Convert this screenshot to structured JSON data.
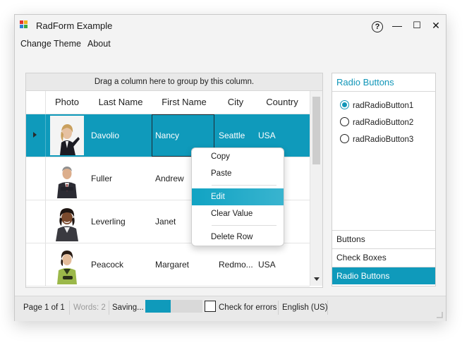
{
  "window": {
    "title": "RadForm Example",
    "help_glyph": "?",
    "minimize_glyph": "—",
    "maximize_glyph": "☐",
    "close_glyph": "✕"
  },
  "menu": {
    "items": [
      "Change Theme",
      "About"
    ]
  },
  "grid": {
    "group_panel_text": "Drag a column here to group by this column.",
    "columns": [
      "Photo",
      "Last Name",
      "First Name",
      "City",
      "Country"
    ],
    "rows": [
      {
        "last_name": "Davolio",
        "first_name": "Nancy",
        "city": "Seattle",
        "country": "USA",
        "photo": "person-photo-icon"
      },
      {
        "last_name": "Fuller",
        "first_name": "Andrew",
        "city": "",
        "country": "",
        "photo": "person-photo-icon"
      },
      {
        "last_name": "Leverling",
        "first_name": "Janet",
        "city": "",
        "country": "",
        "photo": "person-photo-icon"
      },
      {
        "last_name": "Peacock",
        "first_name": "Margaret",
        "city": "Redmo...",
        "country": "USA",
        "photo": "person-photo-icon"
      }
    ]
  },
  "context_menu": {
    "items": [
      "Copy",
      "Paste",
      "Edit",
      "Clear Value",
      "Delete Row"
    ],
    "highlighted": "Edit"
  },
  "right_panel": {
    "header": "Radio Buttons",
    "radios": [
      "radRadioButton1",
      "radRadioButton2",
      "radRadioButton3"
    ],
    "selected_radio": "radRadioButton1",
    "nav_items": [
      "Buttons",
      "Check Boxes",
      "Radio Buttons"
    ],
    "active_nav": "Radio Buttons"
  },
  "status_bar": {
    "page": "Page 1 of 1",
    "words": "Words: 2",
    "saving": "Saving...",
    "progress": 0.45,
    "check_label": "Check for errors",
    "language": "English (US)"
  },
  "colors": {
    "accent": "#0f9abb",
    "window_bg": "#f3f3f3"
  }
}
